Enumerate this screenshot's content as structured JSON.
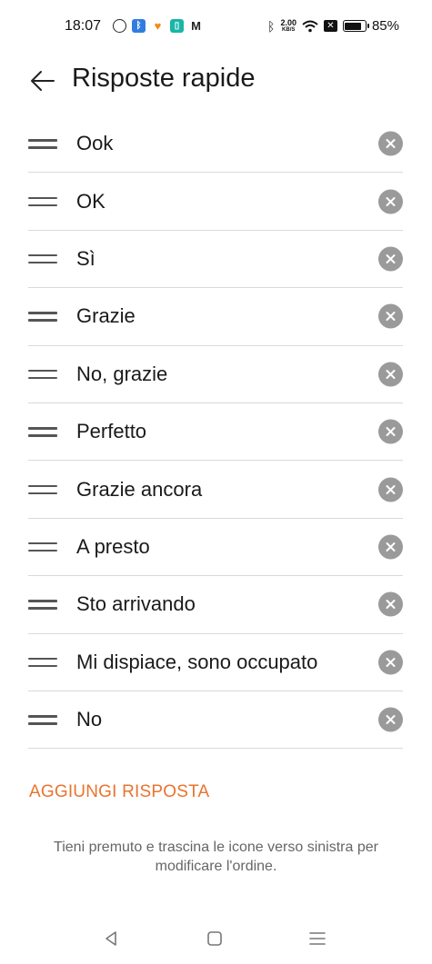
{
  "status_bar": {
    "time": "18:07",
    "left_icons": [
      "whatsapp-icon",
      "bluetooth-app-icon",
      "heart-app-icon",
      "phone-app-icon",
      "gmail-icon"
    ],
    "net_speed_value": "2.00",
    "net_speed_unit": "KB/S",
    "battery": "85%"
  },
  "header": {
    "title": "Risposte rapide",
    "back_icon": "arrow-left-icon"
  },
  "replies": [
    {
      "label": "Ook"
    },
    {
      "label": "OK"
    },
    {
      "label": "Sì"
    },
    {
      "label": "Grazie"
    },
    {
      "label": "No, grazie"
    },
    {
      "label": "Perfetto"
    },
    {
      "label": "Grazie ancora"
    },
    {
      "label": "A presto"
    },
    {
      "label": "Sto arrivando"
    },
    {
      "label": "Mi dispiace, sono occupato"
    },
    {
      "label": "No"
    }
  ],
  "add_button": "AGGIUNGI RISPOSTA",
  "hint": "Tieni premuto e trascina le icone verso sinistra per modificare l'ordine.",
  "colors": {
    "accent": "#e8742f",
    "remove_icon_bg": "#9a9a9a",
    "divider": "#d9d9d9"
  },
  "nav_bar": {
    "back": "triangle-back-icon",
    "home": "square-home-icon",
    "recents": "menu-lines-icon"
  }
}
